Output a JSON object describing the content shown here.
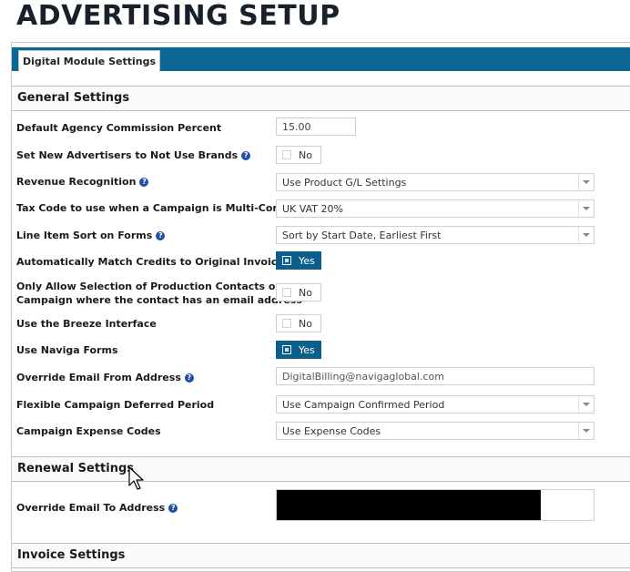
{
  "page": {
    "title": "ADVERTISING SETUP"
  },
  "tabs": [
    {
      "label": "Digital Module Settings"
    }
  ],
  "sections": {
    "general": "General Settings",
    "renewal": "Renewal Settings",
    "next": "Invoice Settings"
  },
  "general": {
    "commission": {
      "label": "Default Agency Commission Percent",
      "value": "15.00"
    },
    "no_brands": {
      "label": "Set New Advertisers to Not Use Brands",
      "value": "No"
    },
    "revenue": {
      "label": "Revenue Recognition",
      "value": "Use Product G/L Settings"
    },
    "tax_code": {
      "label": "Tax Code to use when a Campaign is Multi-Company",
      "value": "UK VAT 20%"
    },
    "sort": {
      "label": "Line Item Sort on Forms",
      "value": "Sort by Start Date, Earliest First"
    },
    "match_credits": {
      "label": "Automatically Match Credits to Original Invoices",
      "value": "Yes"
    },
    "production_contacts": {
      "label_line1": "Only Allow Selection of Production Contacts on a",
      "label_line2": "Campaign where the contact has an email address",
      "value": "No"
    },
    "breeze": {
      "label": "Use the Breeze Interface",
      "value": "No"
    },
    "naviga_forms": {
      "label": "Use Naviga Forms",
      "value": "Yes"
    },
    "email_from": {
      "label": "Override Email From Address",
      "value": "DigitalBilling@navigaglobal.com"
    },
    "deferred": {
      "label": "Flexible Campaign Deferred Period",
      "value": "Use Campaign Confirmed Period"
    },
    "expense": {
      "label": "Campaign Expense Codes",
      "value": "Use Expense Codes"
    }
  },
  "renewal": {
    "email_to": {
      "label": "Override Email To Address"
    }
  },
  "icons": {
    "help": "question-circle-icon",
    "cursor": "mouse-pointer-icon"
  },
  "colors": {
    "accent": "#0b6896",
    "toggle_on": "#0b5f8a",
    "help": "#1f4ea3"
  }
}
